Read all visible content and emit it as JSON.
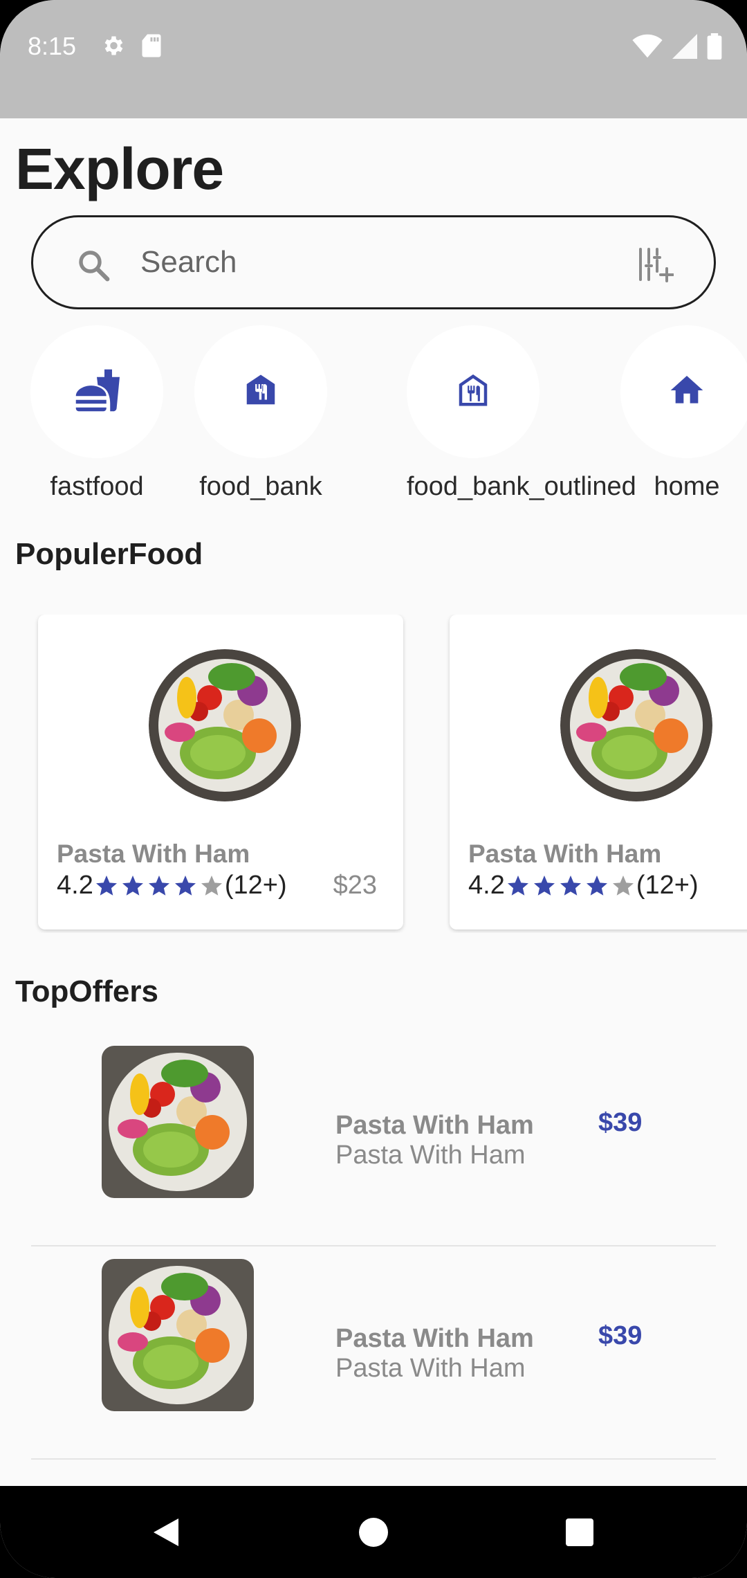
{
  "status_bar": {
    "time": "8:15",
    "left_icons": [
      "gear-icon",
      "sd-card-icon"
    ],
    "right_icons": [
      "wifi-icon",
      "signal-icon",
      "battery-icon"
    ]
  },
  "page": {
    "title": "Explore"
  },
  "search": {
    "placeholder": "Search",
    "value": ""
  },
  "categories": [
    {
      "label": "fastfood",
      "icon": "fastfood-icon"
    },
    {
      "label": "food_bank",
      "icon": "food-bank-icon"
    },
    {
      "label": "food_bank_outlined",
      "icon": "food-bank-outlined-icon"
    },
    {
      "label": "home",
      "icon": "home-icon"
    }
  ],
  "popular": {
    "title": "PopulerFood",
    "items": [
      {
        "name": "Pasta With Ham",
        "rating": "4.2",
        "stars": 4,
        "reviews": "(12+)",
        "price": "$23"
      },
      {
        "name": "Pasta With Ham",
        "rating": "4.2",
        "stars": 4,
        "reviews": "(12+)",
        "price": ""
      }
    ]
  },
  "offers": {
    "title": "TopOffers",
    "items": [
      {
        "title": "Pasta With Ham",
        "subtitle": "Pasta With Ham",
        "price": "$39"
      },
      {
        "title": "Pasta With Ham",
        "subtitle": "Pasta With Ham",
        "price": "$39"
      }
    ]
  },
  "colors": {
    "accent": "#3948ab",
    "star_filled": "#3948ab",
    "star_empty": "#9e9e9e",
    "status_bar": "#bdbdbd",
    "background": "#fafafa"
  },
  "nav": [
    "back-icon",
    "home-circle-icon",
    "recents-icon"
  ]
}
